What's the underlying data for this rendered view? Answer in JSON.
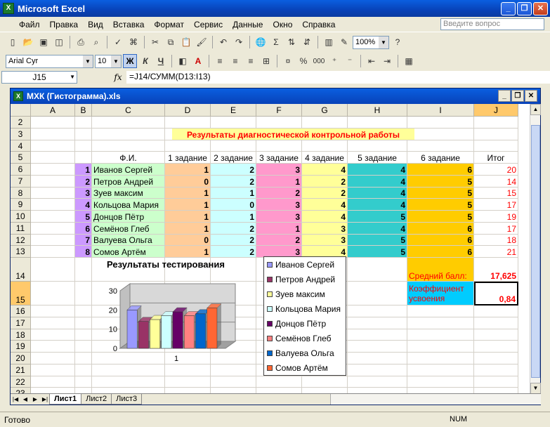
{
  "app": {
    "title": "Microsoft Excel"
  },
  "menu": [
    "Файл",
    "Правка",
    "Вид",
    "Вставка",
    "Формат",
    "Сервис",
    "Данные",
    "Окно",
    "Справка"
  ],
  "help_placeholder": "Введите вопрос",
  "toolbar": {
    "zoom": "100%",
    "font": "Arial Cyr",
    "size": "10",
    "bold": "Ж",
    "italic": "К",
    "underline": "Ч",
    "percent": "%",
    "thousands": "000"
  },
  "formula_bar": {
    "cell_ref": "J15",
    "fx": "fx",
    "formula": "=J14/СУММ(D13:I13)"
  },
  "workbook": {
    "title": "МХК (Гистограмма).xls"
  },
  "columns": [
    "A",
    "B",
    "C",
    "D",
    "E",
    "F",
    "G",
    "H",
    "I",
    "J"
  ],
  "rows": [
    "2",
    "3",
    "4",
    "5",
    "6",
    "7",
    "8",
    "9",
    "10",
    "11",
    "12",
    "13",
    "14",
    "15",
    "16",
    "17",
    "18",
    "19",
    "20",
    "21",
    "22",
    "23"
  ],
  "sheet": {
    "heading": "Результаты диагностической контрольной работы",
    "headers": [
      "Ф.И.",
      "1 задание",
      "2 задание",
      "3 задание",
      "4 задание",
      "5 задание",
      "6 задание",
      "Итог"
    ],
    "students": [
      {
        "n": "1",
        "name": "Иванов Сергей",
        "scores": [
          "1",
          "2",
          "3",
          "4",
          "4",
          "6"
        ],
        "total": "20"
      },
      {
        "n": "2",
        "name": "Петров Андрей",
        "scores": [
          "0",
          "2",
          "1",
          "2",
          "4",
          "5"
        ],
        "total": "14"
      },
      {
        "n": "3",
        "name": "Зуев максим",
        "scores": [
          "1",
          "1",
          "2",
          "2",
          "4",
          "5"
        ],
        "total": "15"
      },
      {
        "n": "4",
        "name": "Кольцова Мария",
        "scores": [
          "1",
          "0",
          "3",
          "4",
          "4",
          "5"
        ],
        "total": "17"
      },
      {
        "n": "5",
        "name": "Донцов Пётр",
        "scores": [
          "1",
          "1",
          "3",
          "4",
          "5",
          "5"
        ],
        "total": "19"
      },
      {
        "n": "6",
        "name": "Семёнов Глеб",
        "scores": [
          "1",
          "2",
          "1",
          "3",
          "4",
          "6"
        ],
        "total": "17"
      },
      {
        "n": "7",
        "name": "Валуева Ольга",
        "scores": [
          "0",
          "2",
          "2",
          "3",
          "5",
          "6"
        ],
        "total": "18"
      },
      {
        "n": "8",
        "name": "Сомов Артём",
        "scores": [
          "1",
          "2",
          "3",
          "4",
          "5",
          "6"
        ],
        "total": "21"
      }
    ],
    "avg_label": "Средний балл:",
    "avg_value": "17,625",
    "coef_label_1": "Коэффициент",
    "coef_label_2": "усвоения",
    "coef_value": "0,84"
  },
  "chart_data": {
    "type": "bar",
    "title": "Результаты тестирования",
    "categories": [
      "1"
    ],
    "series": [
      {
        "name": "Иванов Сергей",
        "values": [
          20
        ],
        "color": "#9999ff"
      },
      {
        "name": "Петров Андрей",
        "values": [
          14
        ],
        "color": "#993366"
      },
      {
        "name": "Зуев максим",
        "values": [
          15
        ],
        "color": "#ffff99"
      },
      {
        "name": "Кольцова Мария",
        "values": [
          17
        ],
        "color": "#ccffff"
      },
      {
        "name": "Донцов Пётр",
        "values": [
          19
        ],
        "color": "#660066"
      },
      {
        "name": "Семёнов Глеб",
        "values": [
          17
        ],
        "color": "#ff8080"
      },
      {
        "name": "Валуева Ольга",
        "values": [
          18
        ],
        "color": "#0066cc"
      },
      {
        "name": "Сомов Артём",
        "values": [
          21
        ],
        "color": "#ff6633"
      }
    ],
    "yticks": [
      "0",
      "10",
      "20",
      "30"
    ],
    "ylim": [
      0,
      30
    ],
    "legend": "right"
  },
  "tabs": [
    "Лист1",
    "Лист2",
    "Лист3"
  ],
  "status": {
    "left": "Готово",
    "num": "NUM"
  }
}
